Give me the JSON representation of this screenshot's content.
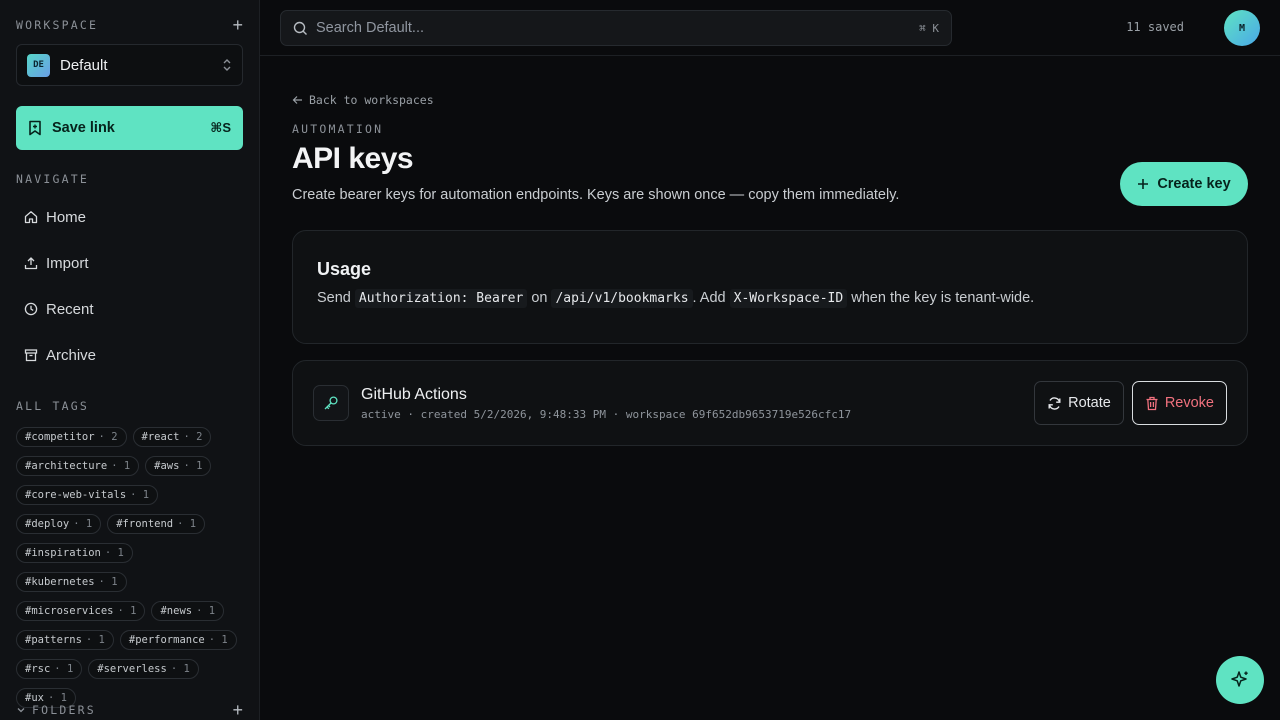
{
  "sidebar": {
    "workspace_label": "WORKSPACE",
    "workspace_badge": "DE",
    "workspace_name": "Default",
    "save_link_label": "Save link",
    "save_link_shortcut": "⌘S",
    "navigate_label": "NAVIGATE",
    "nav_items": [
      {
        "label": "Home",
        "icon": "home-icon"
      },
      {
        "label": "Import",
        "icon": "upload-icon"
      },
      {
        "label": "Recent",
        "icon": "clock-icon"
      },
      {
        "label": "Archive",
        "icon": "archive-icon"
      }
    ],
    "tags_label": "ALL TAGS",
    "tags": [
      {
        "name": "#competitor",
        "count": "· 2"
      },
      {
        "name": "#react",
        "count": "· 2"
      },
      {
        "name": "#architecture",
        "count": "· 1"
      },
      {
        "name": "#aws",
        "count": "· 1"
      },
      {
        "name": "#core-web-vitals",
        "count": "· 1"
      },
      {
        "name": "#deploy",
        "count": "· 1"
      },
      {
        "name": "#frontend",
        "count": "· 1"
      },
      {
        "name": "#inspiration",
        "count": "· 1"
      },
      {
        "name": "#kubernetes",
        "count": "· 1"
      },
      {
        "name": "#microservices",
        "count": "· 1"
      },
      {
        "name": "#news",
        "count": "· 1"
      },
      {
        "name": "#patterns",
        "count": "· 1"
      },
      {
        "name": "#performance",
        "count": "· 1"
      },
      {
        "name": "#rsc",
        "count": "· 1"
      },
      {
        "name": "#serverless",
        "count": "· 1"
      },
      {
        "name": "#ux",
        "count": "· 1"
      }
    ],
    "folders_label": "Folders"
  },
  "topbar": {
    "search_placeholder": "Search Default...",
    "search_shortcut": "⌘ K",
    "saved_count": "11 saved",
    "avatar_initial": "M"
  },
  "main": {
    "back_link": "Back to workspaces",
    "eyebrow": "AUTOMATION",
    "title": "API keys",
    "subtitle": "Create bearer keys for automation endpoints. Keys are shown once — copy them immediately.",
    "create_button": "Create key",
    "usage": {
      "heading": "Usage",
      "text_1": "Send",
      "code_1": "Authorization: Bearer",
      "text_2": "on",
      "code_2": "/api/v1/bookmarks",
      "text_3": ". Add",
      "code_3": "X-Workspace-ID",
      "text_4": "when the key is tenant-wide."
    },
    "keys": [
      {
        "name": "GitHub Actions",
        "meta": "active · created 5/2/2026, 9:48:33 PM · workspace 69f652db9653719e526cfc17",
        "rotate_label": "Rotate",
        "revoke_label": "Revoke"
      }
    ]
  },
  "colors": {
    "accent": "#5fe3c2",
    "danger": "#f0717e",
    "background": "#0a0b0d"
  }
}
